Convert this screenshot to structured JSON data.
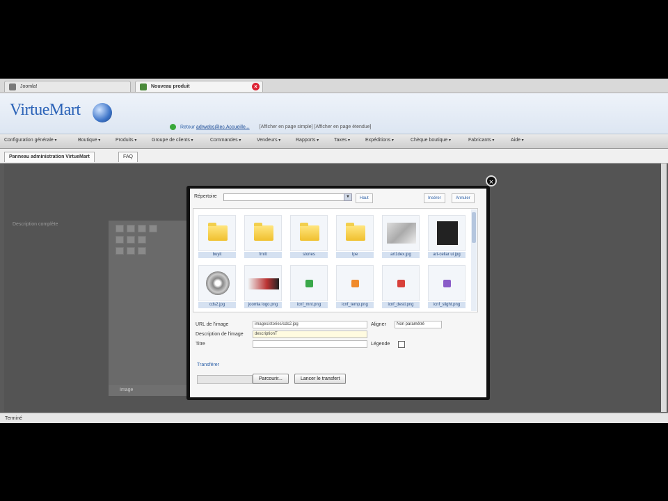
{
  "browser": {
    "tabs": [
      {
        "label": "Joomla!"
      },
      {
        "label": "Nouveau produit"
      }
    ]
  },
  "header": {
    "logo": "VirtueMart",
    "notice_link": "adrwebs@ec.Accueille...",
    "notice_text": "Retour",
    "mode_text": "[Afficher en page simple] [Afficher en page étendue]"
  },
  "menu": {
    "items": [
      "Configuration générale",
      "Boutique",
      "Produits",
      "Groupe de clients",
      "Commandes",
      "Vendeurs",
      "Rapports",
      "Taxes",
      "Expéditions",
      "Chèque boutique",
      "Fabricants",
      "Aide"
    ]
  },
  "subtabs": [
    "Panneau administration VirtueMart",
    "FAQ"
  ],
  "content": {
    "description_label": "Description complète",
    "editor_footer": "Image",
    "status": "Terminé"
  },
  "modal": {
    "directory_label": "Répertoire",
    "directory_value": "",
    "up_button": "Haut",
    "insert_button": "Insérer",
    "cancel_button": "Annuler",
    "files": [
      {
        "name": "buyit",
        "kind": "folder"
      },
      {
        "name": "fmilt",
        "kind": "folder"
      },
      {
        "name": "stories",
        "kind": "folder"
      },
      {
        "name": "Ipe",
        "kind": "folder"
      },
      {
        "name": "art1dex.jpg",
        "kind": "photo"
      },
      {
        "name": "art-cellar ui.jpg",
        "kind": "dark"
      },
      {
        "name": "cds2.jpg",
        "kind": "cd"
      },
      {
        "name": "joomla logo.png",
        "kind": "wide"
      },
      {
        "name": "icnf_mnt.png",
        "kind": "green"
      },
      {
        "name": "icnf_temp.png",
        "kind": "orange"
      },
      {
        "name": "icnf_desti.png",
        "kind": "red"
      },
      {
        "name": "icnf_slight.png",
        "kind": "purple"
      }
    ],
    "form": {
      "url_label": "URL de l'image",
      "url_value": "images/stories/cds2.jpg",
      "desc_label": "Description de l'image",
      "desc_value": "descriptionT",
      "title_label": "Titre",
      "title_value": "",
      "align_label": "Aligner",
      "align_value": "Non paramétré",
      "caption_label": "Légende"
    },
    "upload": {
      "title": "Transférer",
      "browse_button": "Parcourir...",
      "start_button": "Lancer le transfert"
    }
  },
  "colors": {
    "accent": "#2d64b8",
    "folder": "#f0c02e",
    "close": "#d22a33"
  }
}
